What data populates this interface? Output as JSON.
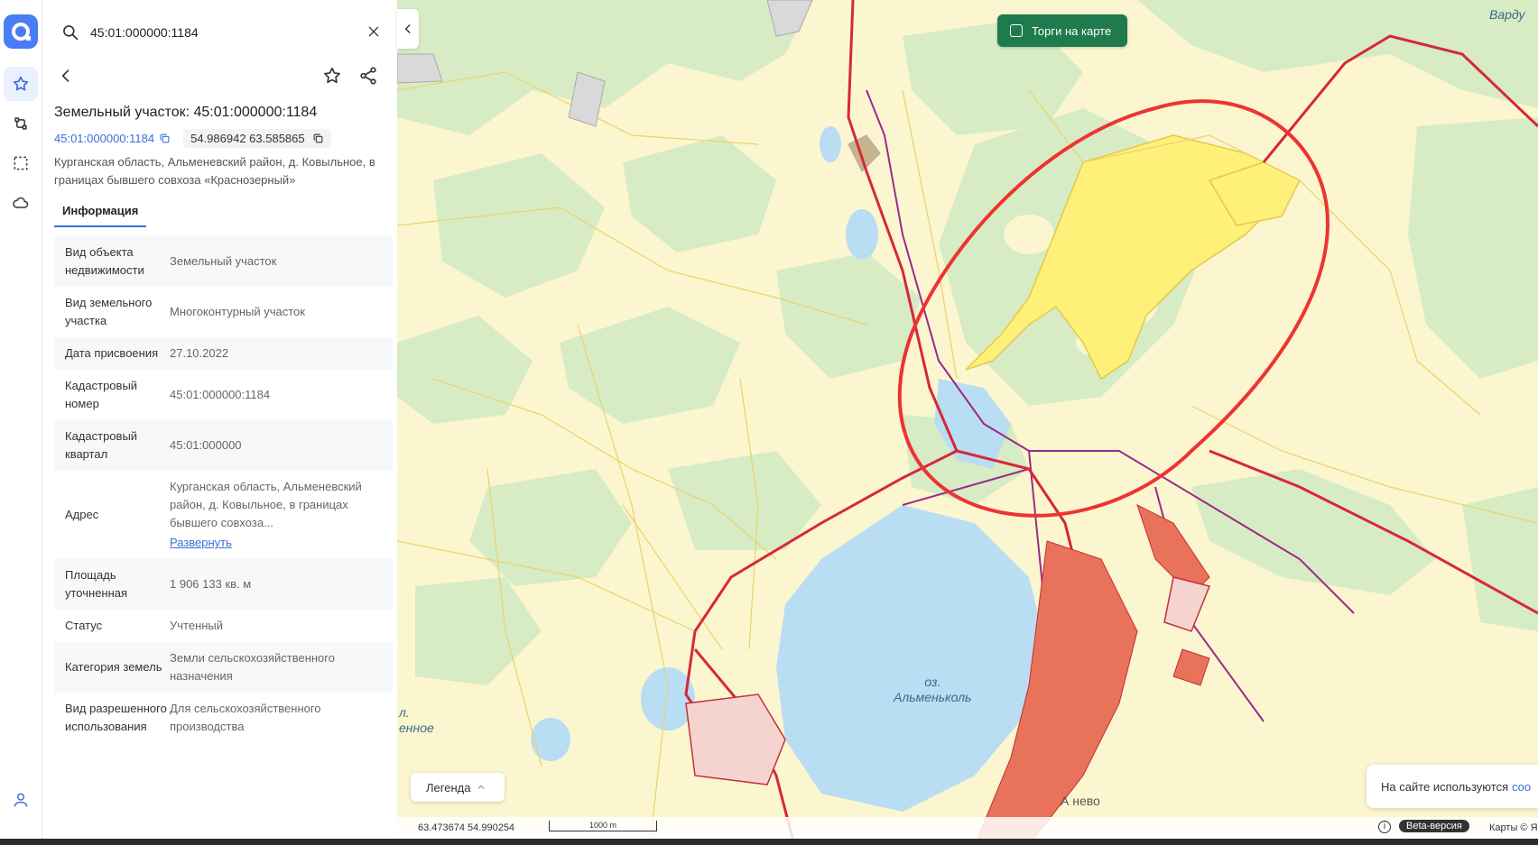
{
  "search": {
    "value": "45:01:000000:1184"
  },
  "parcel": {
    "title": "Земельный участок: 45:01:000000:1184",
    "cadastral_link": "45:01:000000:1184",
    "coords": "54.986942 63.585865",
    "address_full": "Курганская область, Альменевский район, д. Ковыльное, в границах бывшего совхоза «Краснозерный»"
  },
  "tabs": {
    "info": "Информация"
  },
  "rows": [
    {
      "key": "Вид объекта недвижимости",
      "value": "Земельный участок"
    },
    {
      "key": "Вид земельного участка",
      "value": "Многоконтурный участок"
    },
    {
      "key": "Дата присвоения",
      "value": "27.10.2022"
    },
    {
      "key": "Кадастровый номер",
      "value": "45:01:000000:1184"
    },
    {
      "key": "Кадастровый квартал",
      "value": "45:01:000000"
    },
    {
      "key": "Адрес",
      "value": "Курганская область, Альменевский район, д. Ковыльное, в границах бывшего совхоза...",
      "link": "Развернуть"
    },
    {
      "key": "Площадь уточненная",
      "value": "1 906 133 кв. м"
    },
    {
      "key": "Статус",
      "value": "Учтенный"
    },
    {
      "key": "Категория земель",
      "value": "Земли сельскохозяйственного назначения"
    },
    {
      "key": "Вид разрешенного использования",
      "value": "Для сельскохозяйственного производства"
    }
  ],
  "map": {
    "auction_label": "Торги на карте",
    "legend_label": "Легенда",
    "lake_label": "оз.\nАльменьколь",
    "edge_label_left": "л.\nенное",
    "edge_label_topright": "Варду",
    "settlement_label": "А      нево",
    "cookie_text": "На сайте используются",
    "cookie_link": "coo",
    "cursor_coords": "63.473674  54.990254",
    "scale_label": "1000 m",
    "info_icon": "i",
    "beta_label": "Beta-версия",
    "maps_attr": "Карты © Я",
    "colors": {
      "forest": "#d7ecc4",
      "field": "#fbf6cf",
      "water": "#b9ddf2",
      "highlight": "#fff07a",
      "boundary": "#e9d36b",
      "road": "#d6283a",
      "pipeline": "#9b2a8a",
      "annotation": "#ee3333"
    }
  },
  "theme": {
    "accent": "#4a7cf7",
    "link": "#3b6fd8",
    "auction_bg": "#1f7a4d"
  }
}
